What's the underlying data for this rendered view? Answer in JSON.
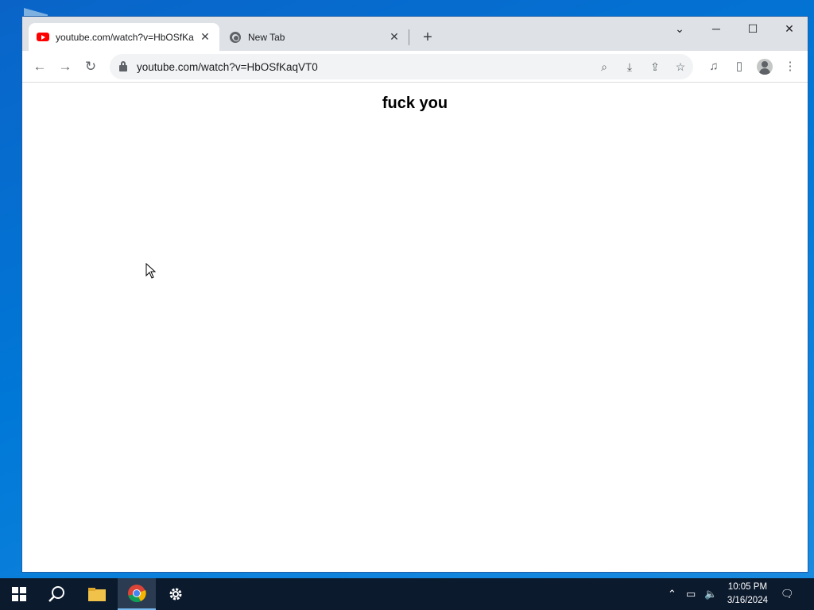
{
  "browser": {
    "tabs": [
      {
        "title": "youtube.com/watch?v=HbOSfKa",
        "active": true,
        "favicon": "youtube-icon"
      },
      {
        "title": "New Tab",
        "active": false,
        "favicon": "chrome-icon"
      }
    ],
    "address": "youtube.com/watch?v=HbOSfKaqVT0"
  },
  "page": {
    "heading": "fuck you"
  },
  "taskbar": {
    "time": "10:05 PM",
    "date": "3/16/2024"
  },
  "colors": {
    "desktop": "#0078d7",
    "taskbar": "#0c1a2e",
    "titlebar": "#dee1e6",
    "youtube_red": "#ff0000"
  }
}
